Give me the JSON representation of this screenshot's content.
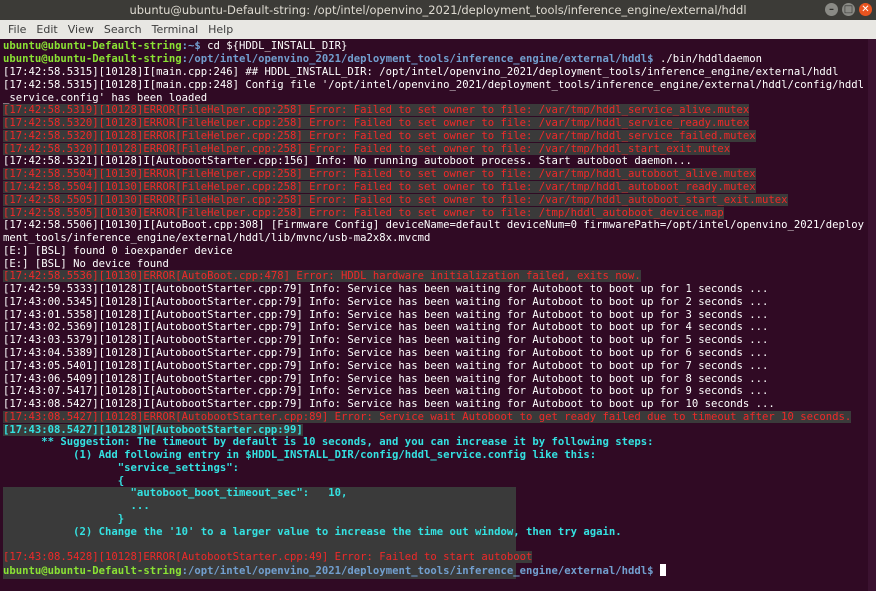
{
  "window": {
    "title": "ubuntu@ubuntu-Default-string: /opt/intel/openvino_2021/deployment_tools/inference_engine/external/hddl",
    "buttons": [
      "–",
      "□",
      "✕"
    ]
  },
  "menu": [
    "File",
    "Edit",
    "View",
    "Search",
    "Terminal",
    "Help"
  ],
  "prompt": {
    "user": "ubuntu@ubuntu-Default-string",
    "home_path": ":~$",
    "hddl_path": ":/opt/intel/openvino_2021/deployment_tools/inference_engine/external/hddl$"
  },
  "commands": {
    "cd": " cd ${HDDL_INSTALL_DIR}",
    "run": " ./bin/hddldaemon"
  },
  "log": [
    {
      "t": "info",
      "text": "[17:42:58.5315][10128]I[main.cpp:246] ## HDDL_INSTALL_DIR: /opt/intel/openvino_2021/deployment_tools/inference_engine/external/hddl"
    },
    {
      "t": "info",
      "text": "[17:42:58.5315][10128]I[main.cpp:248] Config file '/opt/intel/openvino_2021/deployment_tools/inference_engine/external/hddl/config/hddl"
    },
    {
      "t": "info",
      "text": "_service.config' has been loaded"
    },
    {
      "t": "err",
      "text": "[17:42:58.5319][10128]ERROR[FileHelper.cpp:258] Error: Failed to set owner to file: /var/tmp/hddl_service_alive.mutex"
    },
    {
      "t": "err",
      "text": "[17:42:58.5320][10128]ERROR[FileHelper.cpp:258] Error: Failed to set owner to file: /var/tmp/hddl_service_ready.mutex"
    },
    {
      "t": "err",
      "text": "[17:42:58.5320][10128]ERROR[FileHelper.cpp:258] Error: Failed to set owner to file: /var/tmp/hddl_service_failed.mutex"
    },
    {
      "t": "err",
      "text": "[17:42:58.5320][10128]ERROR[FileHelper.cpp:258] Error: Failed to set owner to file: /var/tmp/hddl_start_exit.mutex"
    },
    {
      "t": "info",
      "text": "[17:42:58.5321][10128]I[AutobootStarter.cpp:156] Info: No running autoboot process. Start autoboot daemon..."
    },
    {
      "t": "err",
      "text": "[17:42:58.5504][10130]ERROR[FileHelper.cpp:258] Error: Failed to set owner to file: /var/tmp/hddl_autoboot_alive.mutex"
    },
    {
      "t": "err",
      "text": "[17:42:58.5504][10130]ERROR[FileHelper.cpp:258] Error: Failed to set owner to file: /var/tmp/hddl_autoboot_ready.mutex"
    },
    {
      "t": "err",
      "text": "[17:42:58.5505][10130]ERROR[FileHelper.cpp:258] Error: Failed to set owner to file: /var/tmp/hddl_autoboot_start_exit.mutex"
    },
    {
      "t": "err",
      "text": "[17:42:58.5505][10130]ERROR[FileHelper.cpp:258] Error: Failed to set owner to file: /tmp/hddl_autoboot_device.map"
    },
    {
      "t": "info",
      "text": "[17:42:58.5506][10130]I[AutoBoot.cpp:308] [Firmware Config] deviceName=default deviceNum=0 firmwarePath=/opt/intel/openvino_2021/deploy"
    },
    {
      "t": "info",
      "text": "ment_tools/inference_engine/external/hddl/lib/mvnc/usb-ma2x8x.mvcmd"
    },
    {
      "t": "info",
      "text": "[E:] [BSL] found 0 ioexpander device"
    },
    {
      "t": "info",
      "text": "[E:] [BSL] No device found"
    },
    {
      "t": "err",
      "text": "[17:42:58.5536][10130]ERROR[AutoBoot.cpp:478] Error: HDDL hardware initialization failed, exits now."
    },
    {
      "t": "info",
      "text": "[17:42:59.5333][10128]I[AutobootStarter.cpp:79] Info: Service has been waiting for Autoboot to boot up for 1 seconds ..."
    },
    {
      "t": "info",
      "text": "[17:43:00.5345][10128]I[AutobootStarter.cpp:79] Info: Service has been waiting for Autoboot to boot up for 2 seconds ..."
    },
    {
      "t": "info",
      "text": "[17:43:01.5358][10128]I[AutobootStarter.cpp:79] Info: Service has been waiting for Autoboot to boot up for 3 seconds ..."
    },
    {
      "t": "info",
      "text": "[17:43:02.5369][10128]I[AutobootStarter.cpp:79] Info: Service has been waiting for Autoboot to boot up for 4 seconds ..."
    },
    {
      "t": "info",
      "text": "[17:43:03.5379][10128]I[AutobootStarter.cpp:79] Info: Service has been waiting for Autoboot to boot up for 5 seconds ..."
    },
    {
      "t": "info",
      "text": "[17:43:04.5389][10128]I[AutobootStarter.cpp:79] Info: Service has been waiting for Autoboot to boot up for 6 seconds ..."
    },
    {
      "t": "info",
      "text": "[17:43:05.5401][10128]I[AutobootStarter.cpp:79] Info: Service has been waiting for Autoboot to boot up for 7 seconds ..."
    },
    {
      "t": "info",
      "text": "[17:43:06.5409][10128]I[AutobootStarter.cpp:79] Info: Service has been waiting for Autoboot to boot up for 8 seconds ..."
    },
    {
      "t": "info",
      "text": "[17:43:07.5417][10128]I[AutobootStarter.cpp:79] Info: Service has been waiting for Autoboot to boot up for 9 seconds ..."
    },
    {
      "t": "info",
      "text": "[17:43:08.5427][10128]I[AutobootStarter.cpp:79] Info: Service has been waiting for Autoboot to boot up for 10 seconds ..."
    },
    {
      "t": "err",
      "text": "[17:43:08.5427][10128]ERROR[AutobootStarter.cpp:89] Error: Service wait Autoboot to get ready failed due to timeout after 10 seconds."
    },
    {
      "t": "wrn",
      "text": "[17:43:08.5427][10128]W[AutobootStarter.cpp:99]"
    },
    {
      "t": "sugg",
      "text": "      ** Suggestion: The timeout by default is 10 seconds, and you can increase it by following steps:"
    },
    {
      "t": "sugg",
      "text": "           (1) Add following entry in $HDDL_INSTALL_DIR/config/hddl_service.config like this:"
    },
    {
      "t": "sugg",
      "text": "                  \"service_settings\":"
    },
    {
      "t": "sugg",
      "text": "                  {"
    },
    {
      "t": "sugg",
      "text": "                    \"autoboot_boot_timeout_sec\":   10,"
    },
    {
      "t": "sugg",
      "text": "                    ..."
    },
    {
      "t": "sugg",
      "text": "                  }"
    },
    {
      "t": "sugg",
      "text": "           (2) Change the '10' to a larger value to increase the time out window, then try again."
    },
    {
      "t": "blank",
      "text": ""
    },
    {
      "t": "err",
      "text": "[17:43:08.5428][10128]ERROR[AutobootStarter.cpp:49] Error: Failed to start autoboot"
    }
  ],
  "colors": {
    "background": "#300a24",
    "prompt_user": "#8ae234",
    "prompt_path": "#729fcf",
    "error": "#ef2929",
    "warning": "#34e2e2"
  }
}
